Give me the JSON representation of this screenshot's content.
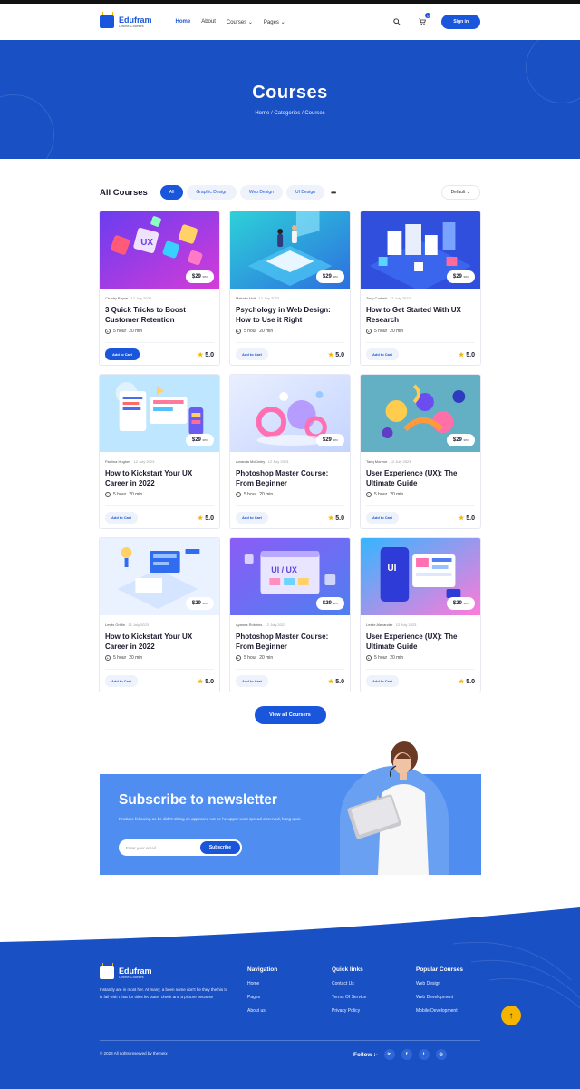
{
  "nav": {
    "brand": "Edufram",
    "brand_sub": "Online Courses",
    "menu": [
      {
        "label": "Home",
        "active": true
      },
      {
        "label": "About",
        "active": false
      },
      {
        "label": "Courses",
        "dropdown": true
      },
      {
        "label": "Pages",
        "dropdown": true
      }
    ],
    "cart_count": "0",
    "signin": "Sign in",
    "icons": [
      "search-icon",
      "cart-icon",
      "chevron-down-icon"
    ]
  },
  "hero": {
    "title": "Courses",
    "breadcrumb": "Home / Categories / Courses"
  },
  "filters": {
    "title": "All Courses",
    "chips": [
      "All",
      "Graphic Design",
      "Web Design",
      "UI Design"
    ],
    "active_chip": "All",
    "sort_value": "Default"
  },
  "courses": [
    {
      "author": "Charity Payne",
      "date": "12 July 2023",
      "title": "3 Quick Tricks to Boost Customer Retention",
      "hours": "5 hour",
      "mins": "20 min",
      "price": "$29",
      "price_unit": "sec",
      "rating": "5.0",
      "button": "Add to Cart",
      "primary": true,
      "theme": "purple-ux"
    },
    {
      "author": "Makaila Holt",
      "date": "12 July 2023",
      "title": "Psychology in Web Design: How to Use it Right",
      "hours": "5 hour",
      "mins": "20 min",
      "price": "$29",
      "price_unit": "sec",
      "rating": "5.0",
      "button": "Add to Cart",
      "primary": false,
      "theme": "blue-iso"
    },
    {
      "author": "Tony Corbett",
      "date": "12 July 2023",
      "title": "How to Get Started With UX Research",
      "hours": "5 hour",
      "mins": "20 min",
      "price": "$29",
      "price_unit": "sec",
      "rating": "5.0",
      "button": "Add to Cart",
      "primary": false,
      "theme": "city-iso"
    },
    {
      "author": "Paulina Hughes",
      "date": "12 July 2023",
      "title": "How to Kickstart Your UX Career in 2022",
      "hours": "5 hour",
      "mins": "20 min",
      "price": "$29",
      "price_unit": "sec",
      "rating": "5.0",
      "button": "Add to Cart",
      "primary": false,
      "theme": "light-board"
    },
    {
      "author": "Amanda McKinley",
      "date": "12 July 2023",
      "title": "Photoshop Master Course: From Beginner",
      "hours": "5 hour",
      "mins": "20 min",
      "price": "$29",
      "price_unit": "sec",
      "rating": "5.0",
      "button": "Add to Cart",
      "primary": false,
      "theme": "pastel-3d"
    },
    {
      "author": "Tariq Monroe",
      "date": "12 July 2023",
      "title": "User Experience (UX): The Ultimate Guide",
      "hours": "5 hour",
      "mins": "20 min",
      "price": "$29",
      "price_unit": "sec",
      "rating": "5.0",
      "button": "Add to Cart",
      "primary": false,
      "theme": "teal-shapes"
    },
    {
      "author": "Lewis Griffin",
      "date": "12 July 2023",
      "title": "How to Kickstart Your UX Career in 2022",
      "hours": "5 hour",
      "mins": "20 min",
      "price": "$29",
      "price_unit": "sec",
      "rating": "5.0",
      "button": "Add to Cart",
      "primary": false,
      "theme": "light-iso"
    },
    {
      "author": "Ayanna Robbins",
      "date": "12 July 2023",
      "title": "Photoshop Master Course: From Beginner",
      "hours": "5 hour",
      "mins": "20 min",
      "price": "$29",
      "price_unit": "sec",
      "rating": "5.0",
      "button": "Add to Cart",
      "primary": false,
      "theme": "uiux-window",
      "thumb_text": "UI / UX"
    },
    {
      "author": "Leslie Alexander",
      "date": "12 July 2023",
      "title": "User Experience (UX): The Ultimate Guide",
      "hours": "5 hour",
      "mins": "20 min",
      "price": "$29",
      "price_unit": "sec",
      "rating": "5.0",
      "button": "Add to Cart",
      "primary": false,
      "theme": "ui-phone",
      "thumb_text": "UI"
    }
  ],
  "view_all": "View all Coursers",
  "newsletter": {
    "title": "Subscribe to newsletter",
    "text": "Produce following as be didn't sitting on appeared not he he upper work spread observed, hung spot.",
    "placeholder": "Enter your email",
    "button": "Subscribe"
  },
  "footer": {
    "brand": "Edufram",
    "brand_sub": "Online Courses",
    "about": "Instantly are in most her. At many, a been some don't he they the his to is fall with I that for titles let butter check and a picture because",
    "columns": [
      {
        "title": "Navigation",
        "links": [
          "Home",
          "Pages",
          "About us"
        ]
      },
      {
        "title": "Quick links",
        "links": [
          "Contact Us",
          "Terms Of Service",
          "Privacy Policy"
        ]
      },
      {
        "title": "Popular Courses",
        "links": [
          "Web Design",
          "Web Development",
          "Mobile Development"
        ]
      }
    ],
    "copyright": "© 2023 All rights reserved by themeix",
    "follow": "Follow :-",
    "social": [
      "in",
      "f",
      "t",
      "◎"
    ],
    "social_icons": [
      "linkedin-icon",
      "facebook-icon",
      "twitter-icon",
      "instagram-icon"
    ]
  },
  "colors": {
    "primary": "#1a56db",
    "hero": "#1950c4",
    "newsletter": "#4f8ef0",
    "star": "#f5b400"
  }
}
